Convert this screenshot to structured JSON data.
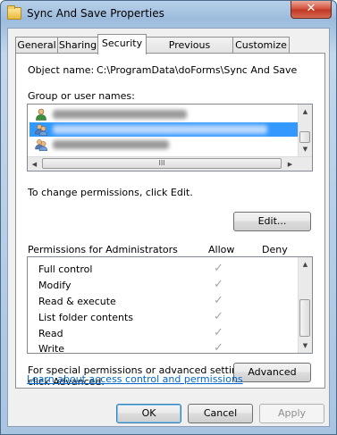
{
  "window": {
    "title": "Sync And Save Properties",
    "close_glyph": "✕",
    "icon": "folder-icon"
  },
  "tabs": [
    {
      "label": "General"
    },
    {
      "label": "Sharing"
    },
    {
      "label": "Security",
      "active": true
    },
    {
      "label": "Previous Versions"
    },
    {
      "label": "Customize"
    }
  ],
  "security": {
    "object_name_label": "Object name:",
    "object_name_value": "C:\\ProgramData\\doForms\\Sync And Save",
    "group_label": "Group or user names:",
    "users": [
      {
        "icon": "user-icon",
        "selected": false
      },
      {
        "icon": "group-icon",
        "selected": true
      },
      {
        "icon": "group-icon",
        "selected": false
      }
    ],
    "change_text": "To change permissions, click Edit.",
    "edit_button": "Edit...",
    "permissions_label": "Permissions for Administrators",
    "allow_header": "Allow",
    "deny_header": "Deny",
    "check_glyph": "✓",
    "permissions": [
      {
        "name": "Full control",
        "allow": true,
        "deny": false
      },
      {
        "name": "Modify",
        "allow": true,
        "deny": false
      },
      {
        "name": "Read & execute",
        "allow": true,
        "deny": false
      },
      {
        "name": "List folder contents",
        "allow": true,
        "deny": false
      },
      {
        "name": "Read",
        "allow": true,
        "deny": false
      },
      {
        "name": "Write",
        "allow": true,
        "deny": false
      }
    ],
    "special_text_1": "For special permissions or advanced settings,",
    "special_text_2": "click Advanced.",
    "advanced_button": "Advanced",
    "learn_link": "Learn about access control and permissions"
  },
  "buttons": {
    "ok": "OK",
    "cancel": "Cancel",
    "apply": "Apply"
  },
  "scrollbar": {
    "up_glyph": "▲",
    "down_glyph": "▼",
    "left_glyph": "◀",
    "right_glyph": "▶",
    "grip_glyph": "III"
  },
  "colors": {
    "selection": "#3399ff",
    "link": "#0066cc",
    "check_disabled": "#a6a6a6"
  }
}
